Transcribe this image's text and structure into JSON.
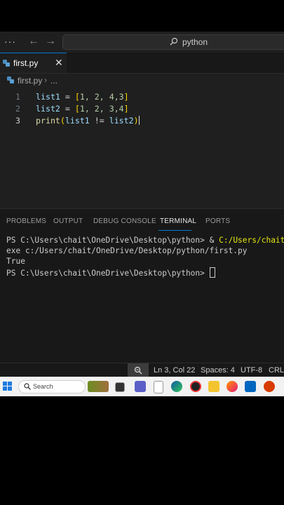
{
  "titlebar": {
    "menu": "···",
    "back": "←",
    "forward": "→",
    "search_text": "python"
  },
  "tab": {
    "label": "first.py",
    "close": "✕"
  },
  "breadcrumb": {
    "file": "first.py",
    "separator": "›",
    "more": "..."
  },
  "editor": {
    "line_numbers": [
      "1",
      "2",
      "3"
    ],
    "lines": [
      {
        "var": "list1",
        "eq": " = ",
        "open": "[",
        "nums": "1, 2, 4,3",
        "close": "]"
      },
      {
        "var": "list2",
        "eq": " = ",
        "open": "[",
        "nums": "1, 2, 3,4",
        "close": "]"
      },
      {
        "func": "print",
        "open": "(",
        "a": "list1",
        "op": " != ",
        "b": "list2",
        "close": ")"
      }
    ]
  },
  "panel": {
    "tabs": [
      "PROBLEMS",
      "OUTPUT",
      "DEBUG CONSOLE",
      "TERMINAL",
      "PORTS"
    ],
    "active_tab": "TERMINAL"
  },
  "terminal": {
    "line1_prompt": "PS C:\\Users\\chait\\OneDrive\\Desktop\\python> ",
    "line1_amp": "& ",
    "line1_cmd": "C:/Users/chait/AppData",
    "line2": "exe c:/Users/chait/OneDrive/Desktop/python/first.py",
    "line3": "True",
    "line4_prompt": "PS C:\\Users\\chait\\OneDrive\\Desktop\\python> "
  },
  "statusbar": {
    "position": "Ln 3, Col 22",
    "spaces": "Spaces: 4",
    "encoding": "UTF-8",
    "eol": "CRLF"
  },
  "taskbar": {
    "search_label": "Search"
  },
  "colors": {
    "accent": "#0078d4",
    "editor_bg": "#1f1f1f",
    "panel_bg": "#181818",
    "terminal_yellow": "#e5e510"
  }
}
